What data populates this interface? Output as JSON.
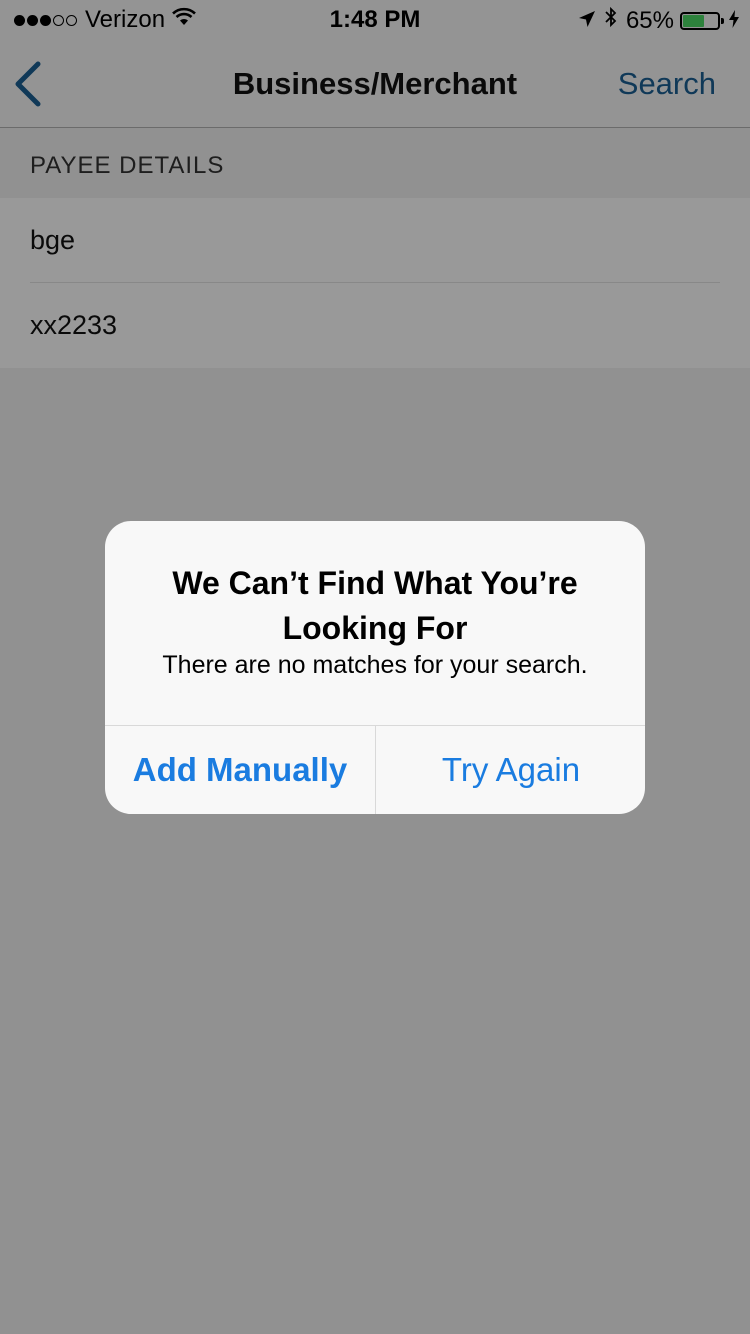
{
  "status_bar": {
    "signal_dots": [
      "full",
      "full",
      "full",
      "empty",
      "empty"
    ],
    "carrier": "Verizon",
    "wifi_icon": "wifi-icon",
    "time": "1:48 PM",
    "location_icon": "location-arrow-icon",
    "bluetooth_icon": "bluetooth-icon",
    "battery_percent": "65%",
    "battery_level": 0.65,
    "charging_icon": "bolt-icon"
  },
  "nav": {
    "back_icon": "chevron-left-icon",
    "title": "Business/Merchant",
    "action_label": "Search",
    "action_color": "#1b5f93"
  },
  "section": {
    "header": "PAYEE DETAILS"
  },
  "payee": {
    "name": "bge",
    "account": "xx2233"
  },
  "alert": {
    "title": "We Can’t Find What You’re Looking For",
    "message": "There are no matches for your search.",
    "primary_button": "Add Manually",
    "secondary_button": "Try Again",
    "button_color": "#1a7ce0"
  },
  "colors": {
    "battery_fill": "#4cd964"
  }
}
